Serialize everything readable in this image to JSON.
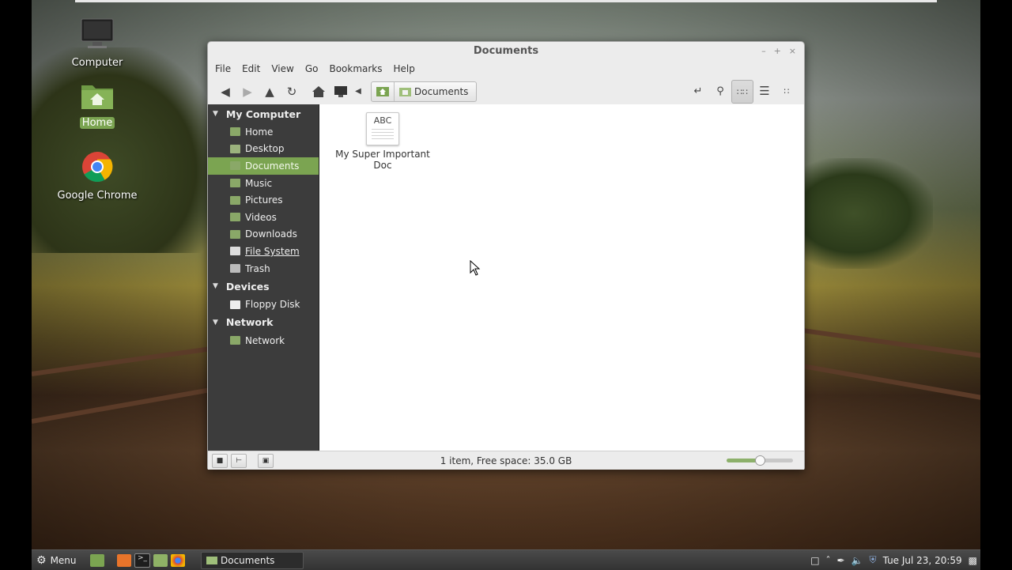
{
  "desktop": {
    "icons": [
      {
        "label": "Computer",
        "icon": "computer-icon",
        "selected": false
      },
      {
        "label": "Home",
        "icon": "home-folder-icon",
        "selected": true
      },
      {
        "label": "Google Chrome",
        "icon": "chrome-icon",
        "selected": false
      }
    ]
  },
  "window": {
    "title": "Documents",
    "controls": [
      "–",
      "+",
      "×"
    ],
    "menu": [
      "File",
      "Edit",
      "View",
      "Go",
      "Bookmarks",
      "Help"
    ],
    "toolbar": {
      "breadcrumb": [
        "Documents"
      ]
    },
    "sidebar": {
      "sections": [
        {
          "title": "My Computer",
          "items": [
            {
              "label": "Home",
              "icon": "home-folder-icon"
            },
            {
              "label": "Desktop",
              "icon": "desktop-icon"
            },
            {
              "label": "Documents",
              "icon": "documents-folder-icon",
              "selected": true
            },
            {
              "label": "Music",
              "icon": "music-folder-icon"
            },
            {
              "label": "Pictures",
              "icon": "pictures-folder-icon"
            },
            {
              "label": "Videos",
              "icon": "videos-folder-icon"
            },
            {
              "label": "Downloads",
              "icon": "downloads-folder-icon"
            },
            {
              "label": "File System",
              "icon": "drive-icon",
              "underline": true
            },
            {
              "label": "Trash",
              "icon": "trash-icon"
            }
          ]
        },
        {
          "title": "Devices",
          "items": [
            {
              "label": "Floppy Disk",
              "icon": "floppy-icon"
            }
          ]
        },
        {
          "title": "Network",
          "items": [
            {
              "label": "Network",
              "icon": "network-icon"
            }
          ]
        }
      ]
    },
    "files": [
      {
        "name": "My Super Important Doc",
        "icon_text": "ABC"
      }
    ],
    "status": "1 item, Free space: 35.0 GB",
    "zoom_level": 0.5
  },
  "panel": {
    "menu_label": "Menu",
    "task_label": "Documents",
    "clock": "Tue Jul 23, 20:59"
  },
  "colors": {
    "accent": "#7ba451",
    "sidebar_bg": "#3c3c3c"
  }
}
